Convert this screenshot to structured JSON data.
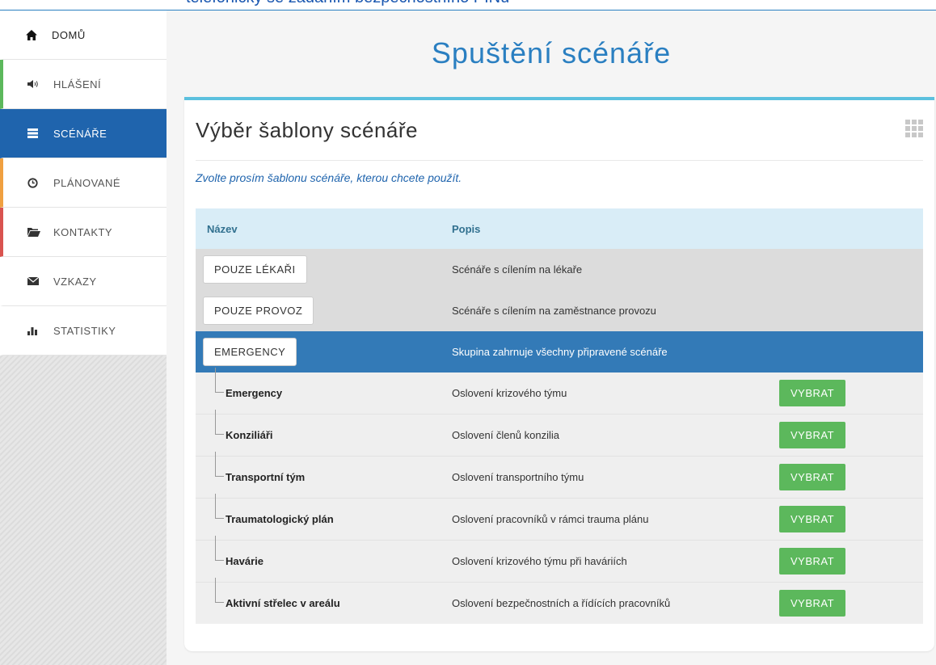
{
  "top_banner": "telefonicky se zadáním bezpečnostního PINu",
  "sidebar": {
    "items": [
      {
        "label": "DOMŮ",
        "icon": "home-icon"
      },
      {
        "label": "HLÁŠENÍ",
        "icon": "speaker-icon"
      },
      {
        "label": "SCÉNÁŘE",
        "icon": "list-icon"
      },
      {
        "label": "PLÁNOVANÉ",
        "icon": "clock-icon"
      },
      {
        "label": "KONTAKTY",
        "icon": "folder-icon"
      },
      {
        "label": "VZKAZY",
        "icon": "envelope-icon"
      },
      {
        "label": "STATISTIKY",
        "icon": "bar-chart-icon"
      }
    ]
  },
  "page": {
    "title": "Spuštění scénáře"
  },
  "panel": {
    "title": "Výběr šablony scénáře",
    "hint": "Zvolte prosím šablonu scénáře, kterou chcete použít."
  },
  "table": {
    "headers": {
      "name": "Název",
      "desc": "Popis"
    },
    "groups": [
      {
        "label": "POUZE LÉKAŘI",
        "desc": "Scénáře s cílením na lékaře"
      },
      {
        "label": "POUZE PROVOZ",
        "desc": "Scénáře s cílením na zaměstnance provozu"
      },
      {
        "label": "EMERGENCY",
        "desc": "Skupina zahrnuje všechny připravené scénáře"
      }
    ],
    "select_label": "VYBRAT",
    "rows": [
      {
        "name": "Emergency",
        "desc": "Oslovení krizového týmu"
      },
      {
        "name": "Konziliáři",
        "desc": "Oslovení členů konzilia"
      },
      {
        "name": "Transportní tým",
        "desc": "Oslovení transportního týmu"
      },
      {
        "name": "Traumatologický plán",
        "desc": "Oslovení pracovníků v rámci trauma plánu"
      },
      {
        "name": "Havárie",
        "desc": "Oslovení krizového týmu při haváriích"
      },
      {
        "name": "Aktivní střelec v areálu",
        "desc": "Oslovení bezpečnostních a řídících pracovníků"
      }
    ]
  },
  "colors": {
    "accent": "#1f64ad",
    "success": "#5cb85c",
    "info_border": "#5bc0de"
  }
}
